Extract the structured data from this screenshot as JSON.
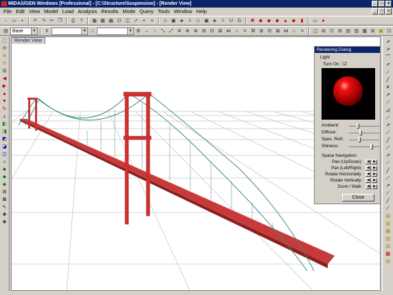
{
  "window": {
    "title": "MIDAS/GEN Windows [Professional] - [C:\\Structure\\Suspension] - [Render View]",
    "min": "_",
    "max": "□",
    "close": "x"
  },
  "menu": [
    "File",
    "Edit",
    "View",
    "Model",
    "Load",
    "Analysis",
    "Results",
    "Mode",
    "Query",
    "Tools",
    "Window",
    "Help"
  ],
  "toolbar": {
    "combo_left": "Base"
  },
  "view": {
    "tab_label": "Render View"
  },
  "dialog": {
    "title": "Rendering Dialog",
    "light_label": "Light",
    "turn_on_label": "Turn On :",
    "turn_on_check": "☑",
    "sliders": [
      {
        "label": "Ambient:",
        "level": 0.25
      },
      {
        "label": "Diffuse:",
        "level": 0.35
      },
      {
        "label": "Spec. Refl.:",
        "level": 0.3
      },
      {
        "label": "Shiness:",
        "level": 0.75
      }
    ],
    "space_nav_label": "Space Navigation",
    "nav": [
      "Pan (Up/Down) :",
      "Pan (Left/Right) :",
      "Rotate Horizontally :",
      "Rotate Vertically :",
      "Zoom / Walk :"
    ],
    "close_label": "Close"
  },
  "colors": {
    "deck": "#c83a3a",
    "tower": "#d03030",
    "cable": "#3a8a86",
    "grid": "#c8c8c8",
    "title_bar": "#0a246a"
  }
}
